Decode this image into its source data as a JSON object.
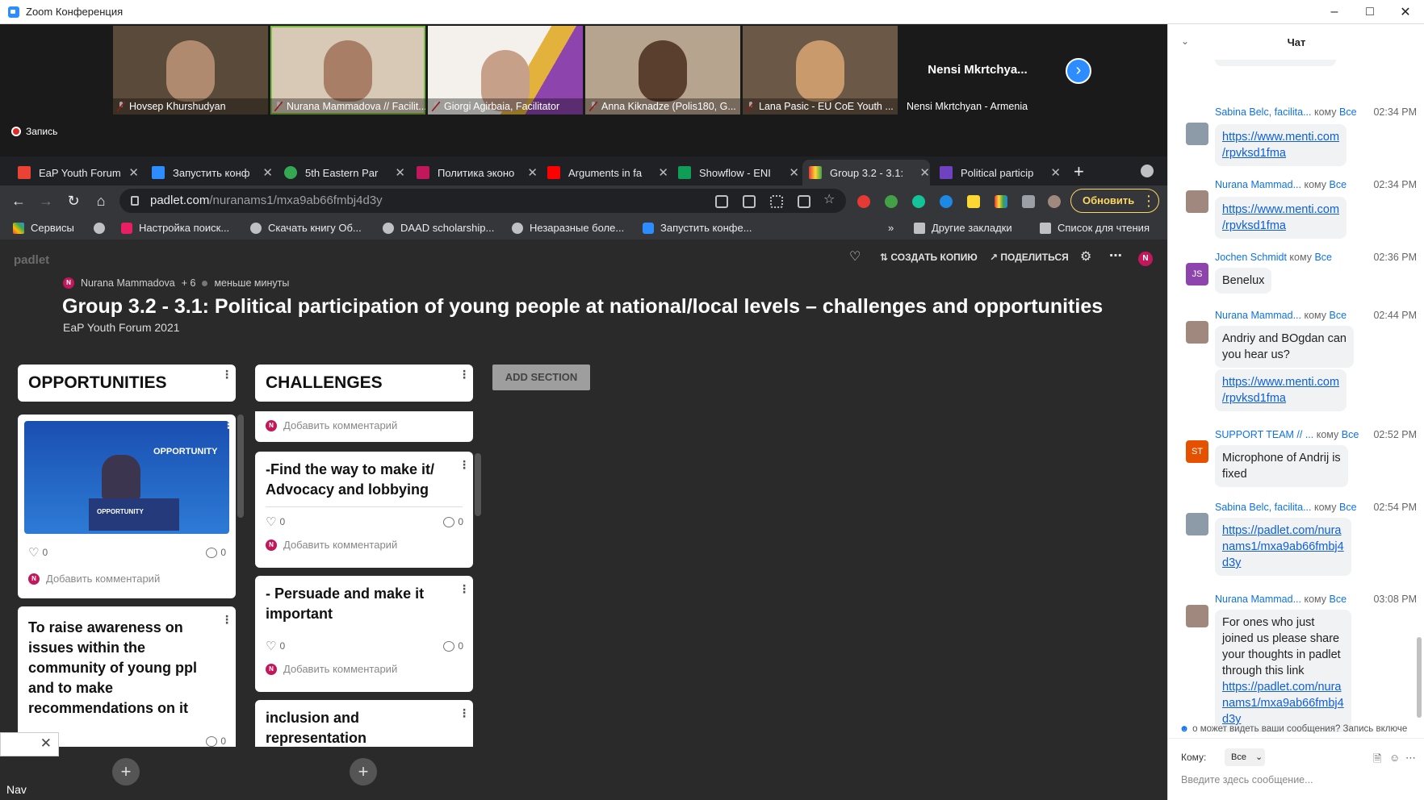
{
  "window": {
    "title": "Zoom Конференция"
  },
  "gallery": {
    "participants": [
      {
        "name": "Hovsep Khurshudyan"
      },
      {
        "name": "Nurana Mammadova // Facilit..."
      },
      {
        "name": "Giorgi Agirbaia, Facilitator"
      },
      {
        "name": "Anna Kiknadze (Polis180, G..."
      },
      {
        "name": "Lana Pasic - EU CoE Youth ..."
      },
      {
        "name": "Nensi Mkrtchyan - Armenia",
        "big_name": "Nensi  Mkrtchya..."
      }
    ],
    "recording_label": "Запись"
  },
  "browser": {
    "tabs": [
      {
        "label": "EaP Youth Forum",
        "color": "#ea4335"
      },
      {
        "label": "Запустить конф",
        "color": "#2d8cff"
      },
      {
        "label": "5th Eastern Par",
        "color": "#34a853"
      },
      {
        "label": "Политика эконо",
        "color": "#c2185b"
      },
      {
        "label": "Arguments in fa",
        "color": "#ff0000"
      },
      {
        "label": "Showflow - ENI",
        "color": "#0f9d58"
      },
      {
        "label": "Group 3.2 - 3.1:",
        "color": "#e8eaed"
      },
      {
        "label": "Political particip",
        "color": "#6f42c1"
      }
    ],
    "url_host": "padlet.com",
    "url_path": "/nuranams1/mxa9ab66fmbj4d3y",
    "update_label": "Обновить",
    "bookmarks": [
      "Сервисы",
      "Настройка поиск...",
      "Скачать книгу Об...",
      "DAAD scholarship...",
      "Незаразные боле...",
      "Запустить конфе...",
      "Другие закладки",
      "Список для чтения"
    ]
  },
  "padlet": {
    "logo": "padlet",
    "copy_label": "СОЗДАТЬ КОПИЮ",
    "share_label": "ПОДЕЛИТЬСЯ",
    "author": "Nurana Mammadova",
    "contributors": "+ 6",
    "updated": "меньше минуты",
    "avatar_letter": "N",
    "title": "Group 3.2 - 3.1: Political participation of young people at national/local levels – challenges and opportunities",
    "subtitle": "EaP Youth Forum 2021",
    "add_section": "ADD SECTION",
    "comment_placeholder": "Добавить комментарий",
    "columns": [
      {
        "title": "OPPORTUNITIES",
        "cards": [
          {
            "image_text": "OPPORTUNITY",
            "likes": "0",
            "comments": "0"
          },
          {
            "text": "To raise awareness on issues within the community of young ppl and to make recommendations on it",
            "comments": "0"
          }
        ]
      },
      {
        "title": "CHALLENGES",
        "cards": [
          {
            "text": ""
          },
          {
            "text": "-Find the way to make it/ Advocacy and lobbying",
            "likes": "0",
            "comments": "0"
          },
          {
            "text": "- Persuade and make it important",
            "likes": "0",
            "comments": "0"
          },
          {
            "text": "inclusion and representation"
          }
        ]
      }
    ]
  },
  "popup": {
    "nav_label": "Nav"
  },
  "chat": {
    "title": "Чат",
    "to_word": "кому",
    "all_word": "Все",
    "messages": [
      {
        "sender": "Sabina Belc, facilita...",
        "time": "02:34 PM",
        "lines": [
          "https://www.menti.com",
          "/rpvksd1fma"
        ],
        "link": true
      },
      {
        "sender": "Nurana Mammad...",
        "time": "02:34 PM",
        "lines": [
          "https://www.menti.com",
          "/rpvksd1fma"
        ],
        "link": true
      },
      {
        "sender": "Jochen Schmidt",
        "time": "02:36 PM",
        "initials": "JS",
        "lines": [
          "Benelux"
        ]
      },
      {
        "sender": "Nurana Mammad...",
        "time": "02:44 PM",
        "lines": [
          "Andriy and BOgdan can",
          "you hear us?"
        ],
        "link_lines": [
          "https://www.menti.com",
          "/rpvksd1fma"
        ]
      },
      {
        "sender": "SUPPORT TEAM // ...",
        "time": "02:52 PM",
        "initials": "ST",
        "lines": [
          "Microphone of Andrij is",
          "fixed"
        ]
      },
      {
        "sender": "Sabina Belc, facilita...",
        "time": "02:54 PM",
        "lines": [
          "https://padlet.com/nura",
          "nams1/mxa9ab66fmbj4",
          "d3y"
        ],
        "link": true
      },
      {
        "sender": "Nurana Mammad...",
        "time": "03:08 PM",
        "lines": [
          "For ones who just",
          "joined us please share",
          "your thoughts in padlet",
          "through this link"
        ],
        "link_lines": [
          "https://padlet.com/nura",
          "nams1/mxa9ab66fmbj4",
          "d3y"
        ]
      }
    ],
    "notice": "о может видеть ваши сообщения? Запись включе",
    "to_label": "Кому:",
    "to_value": "Все",
    "input_placeholder": "Введите здесь сообщение..."
  }
}
